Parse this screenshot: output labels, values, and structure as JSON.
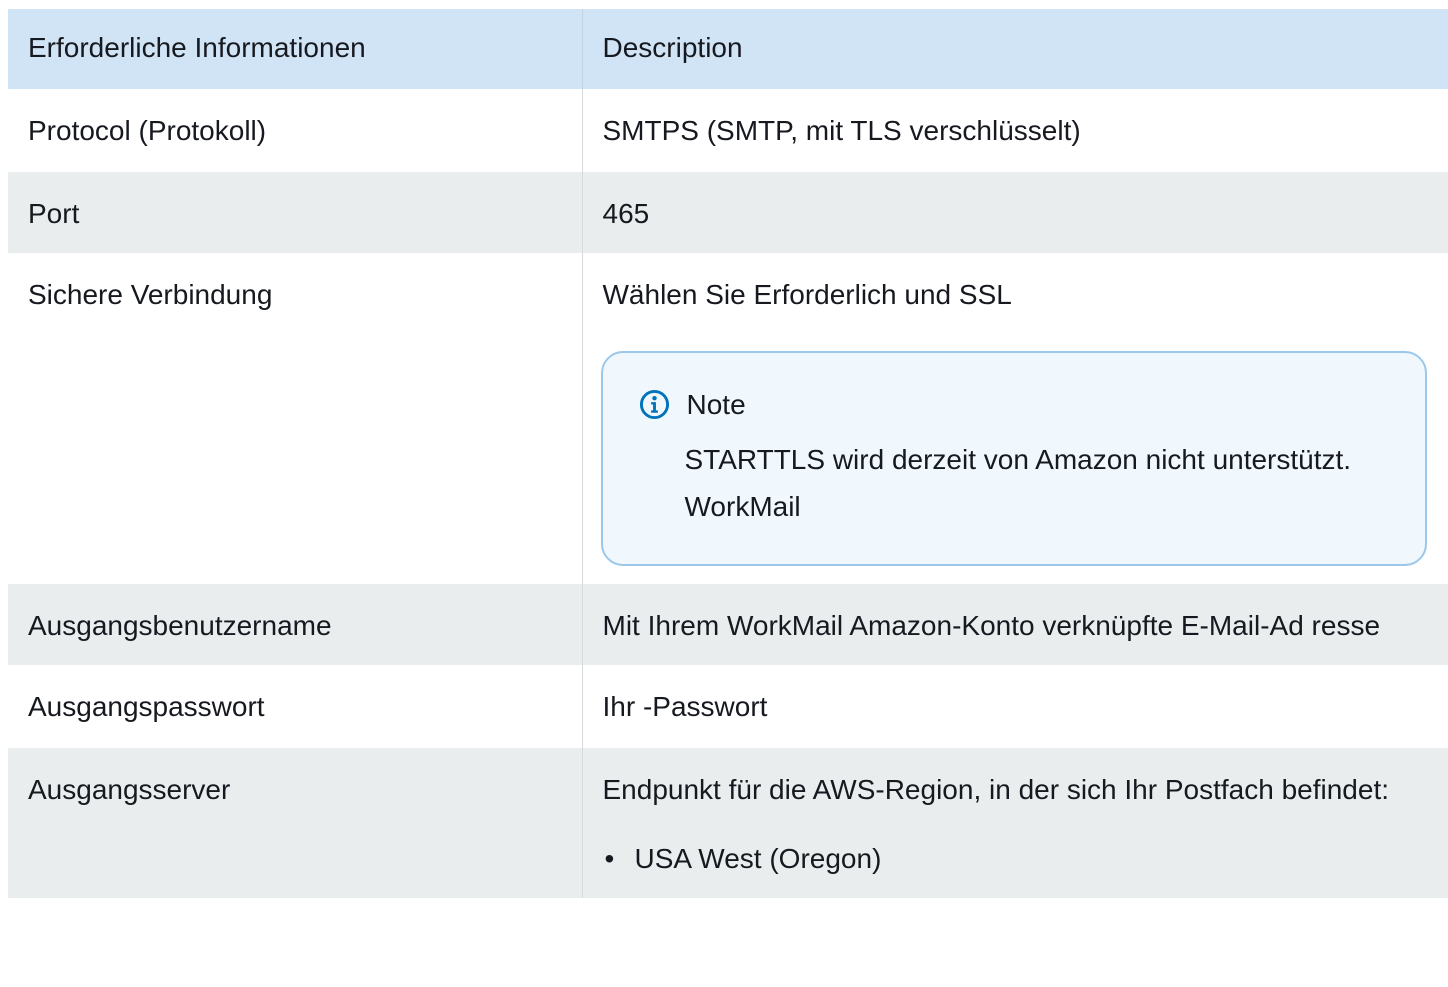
{
  "table": {
    "headers": [
      "Erforderliche Informationen",
      "Description"
    ],
    "rows": [
      {
        "label": "Protocol (Protokoll)",
        "value": "SMTPS (SMTP, mit TLS verschlüsselt)"
      },
      {
        "label": "Port",
        "value": "465"
      },
      {
        "label": "Sichere Verbindung",
        "value": "Wählen Sie Erforderlich und SSL",
        "note": {
          "icon": "info-icon",
          "title": "Note",
          "text": "STARTTLS wird derzeit von Amazon nicht unterstützt. WorkMail"
        }
      },
      {
        "label": "Ausgangsbenutzername",
        "value": "Mit Ihrem WorkMail Amazon-Konto verknüpfte E-Mail-Ad resse"
      },
      {
        "label": "Ausgangspasswort",
        "value": "Ihr -Passwort"
      },
      {
        "label": "Ausgangsserver",
        "value": "Endpunkt für die AWS-Region, in der sich Ihr Postfach befindet:",
        "list": [
          "USA West (Oregon)"
        ]
      }
    ]
  },
  "colors": {
    "header_bg": "#d1e4f6",
    "row_alt_bg": "#eaeded",
    "note_border": "#9bc8ea",
    "note_bg": "#f1f8fd",
    "info_icon": "#0073bb"
  }
}
